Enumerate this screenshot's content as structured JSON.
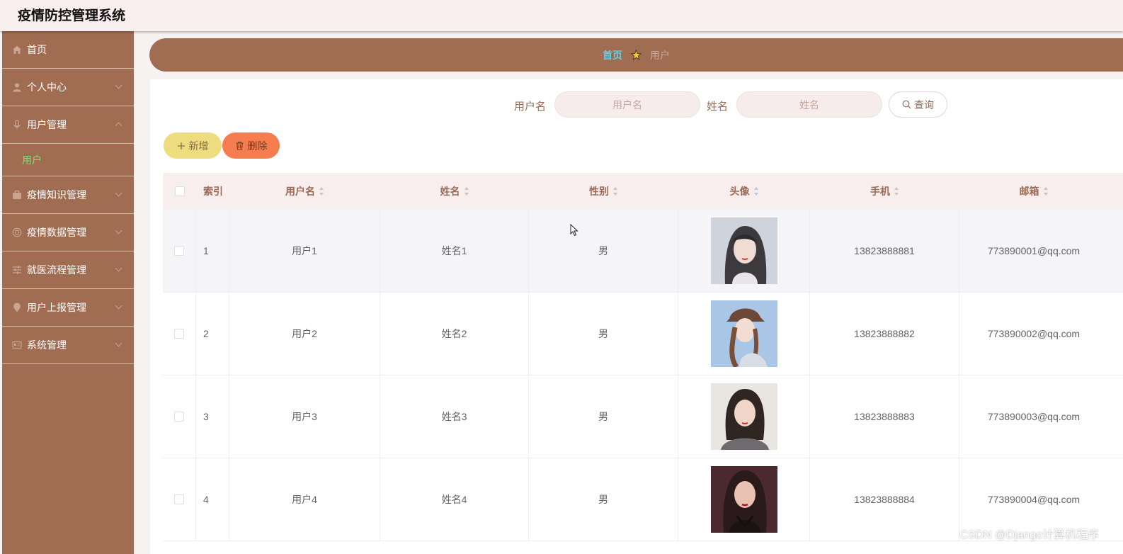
{
  "app": {
    "title": "疫情防控管理系统"
  },
  "sidebar": {
    "items": [
      {
        "label": "首页",
        "icon": "home-icon"
      },
      {
        "label": "个人中心",
        "icon": "person-icon"
      },
      {
        "label": "用户管理",
        "icon": "mic-icon",
        "expanded": true
      },
      {
        "label": "疫情知识管理",
        "icon": "briefcase-icon"
      },
      {
        "label": "疫情数据管理",
        "icon": "lifebuoy-icon"
      },
      {
        "label": "就医流程管理",
        "icon": "sliders-icon"
      },
      {
        "label": "用户上报管理",
        "icon": "location-pin-icon"
      },
      {
        "label": "系统管理",
        "icon": "id-card-icon"
      }
    ],
    "submenu": {
      "label": "用户",
      "color": "#7fe07a"
    }
  },
  "breadcrumb": {
    "home": "首页",
    "current": "用户"
  },
  "search": {
    "username_label": "用户名",
    "username_placeholder": "用户名",
    "name_label": "姓名",
    "name_placeholder": "姓名",
    "query_label": "查询"
  },
  "actions": {
    "add_label": "新增",
    "delete_label": "删除"
  },
  "table": {
    "headers": {
      "index": "索引",
      "username": "用户名",
      "name": "姓名",
      "gender": "性别",
      "avatar": "头像",
      "phone": "手机",
      "email": "邮箱"
    },
    "rows": [
      {
        "index": "1",
        "username": "用户1",
        "name": "姓名1",
        "gender": "男",
        "phone": "13823888881",
        "email": "773890001@qq.com"
      },
      {
        "index": "2",
        "username": "用户2",
        "name": "姓名2",
        "gender": "男",
        "phone": "13823888882",
        "email": "773890002@qq.com"
      },
      {
        "index": "3",
        "username": "用户3",
        "name": "姓名3",
        "gender": "男",
        "phone": "13823888883",
        "email": "773890003@qq.com"
      },
      {
        "index": "4",
        "username": "用户4",
        "name": "姓名4",
        "gender": "男",
        "phone": "13823888884",
        "email": "773890004@qq.com"
      }
    ]
  },
  "watermark": "CSDN @Django计算机程序",
  "colors": {
    "sidebar": "#a06c52",
    "accent_text": "#9a6b55",
    "add_button": "#eedd7e",
    "delete_button": "#f67d50",
    "crumb_home": "#5fd0e6"
  }
}
